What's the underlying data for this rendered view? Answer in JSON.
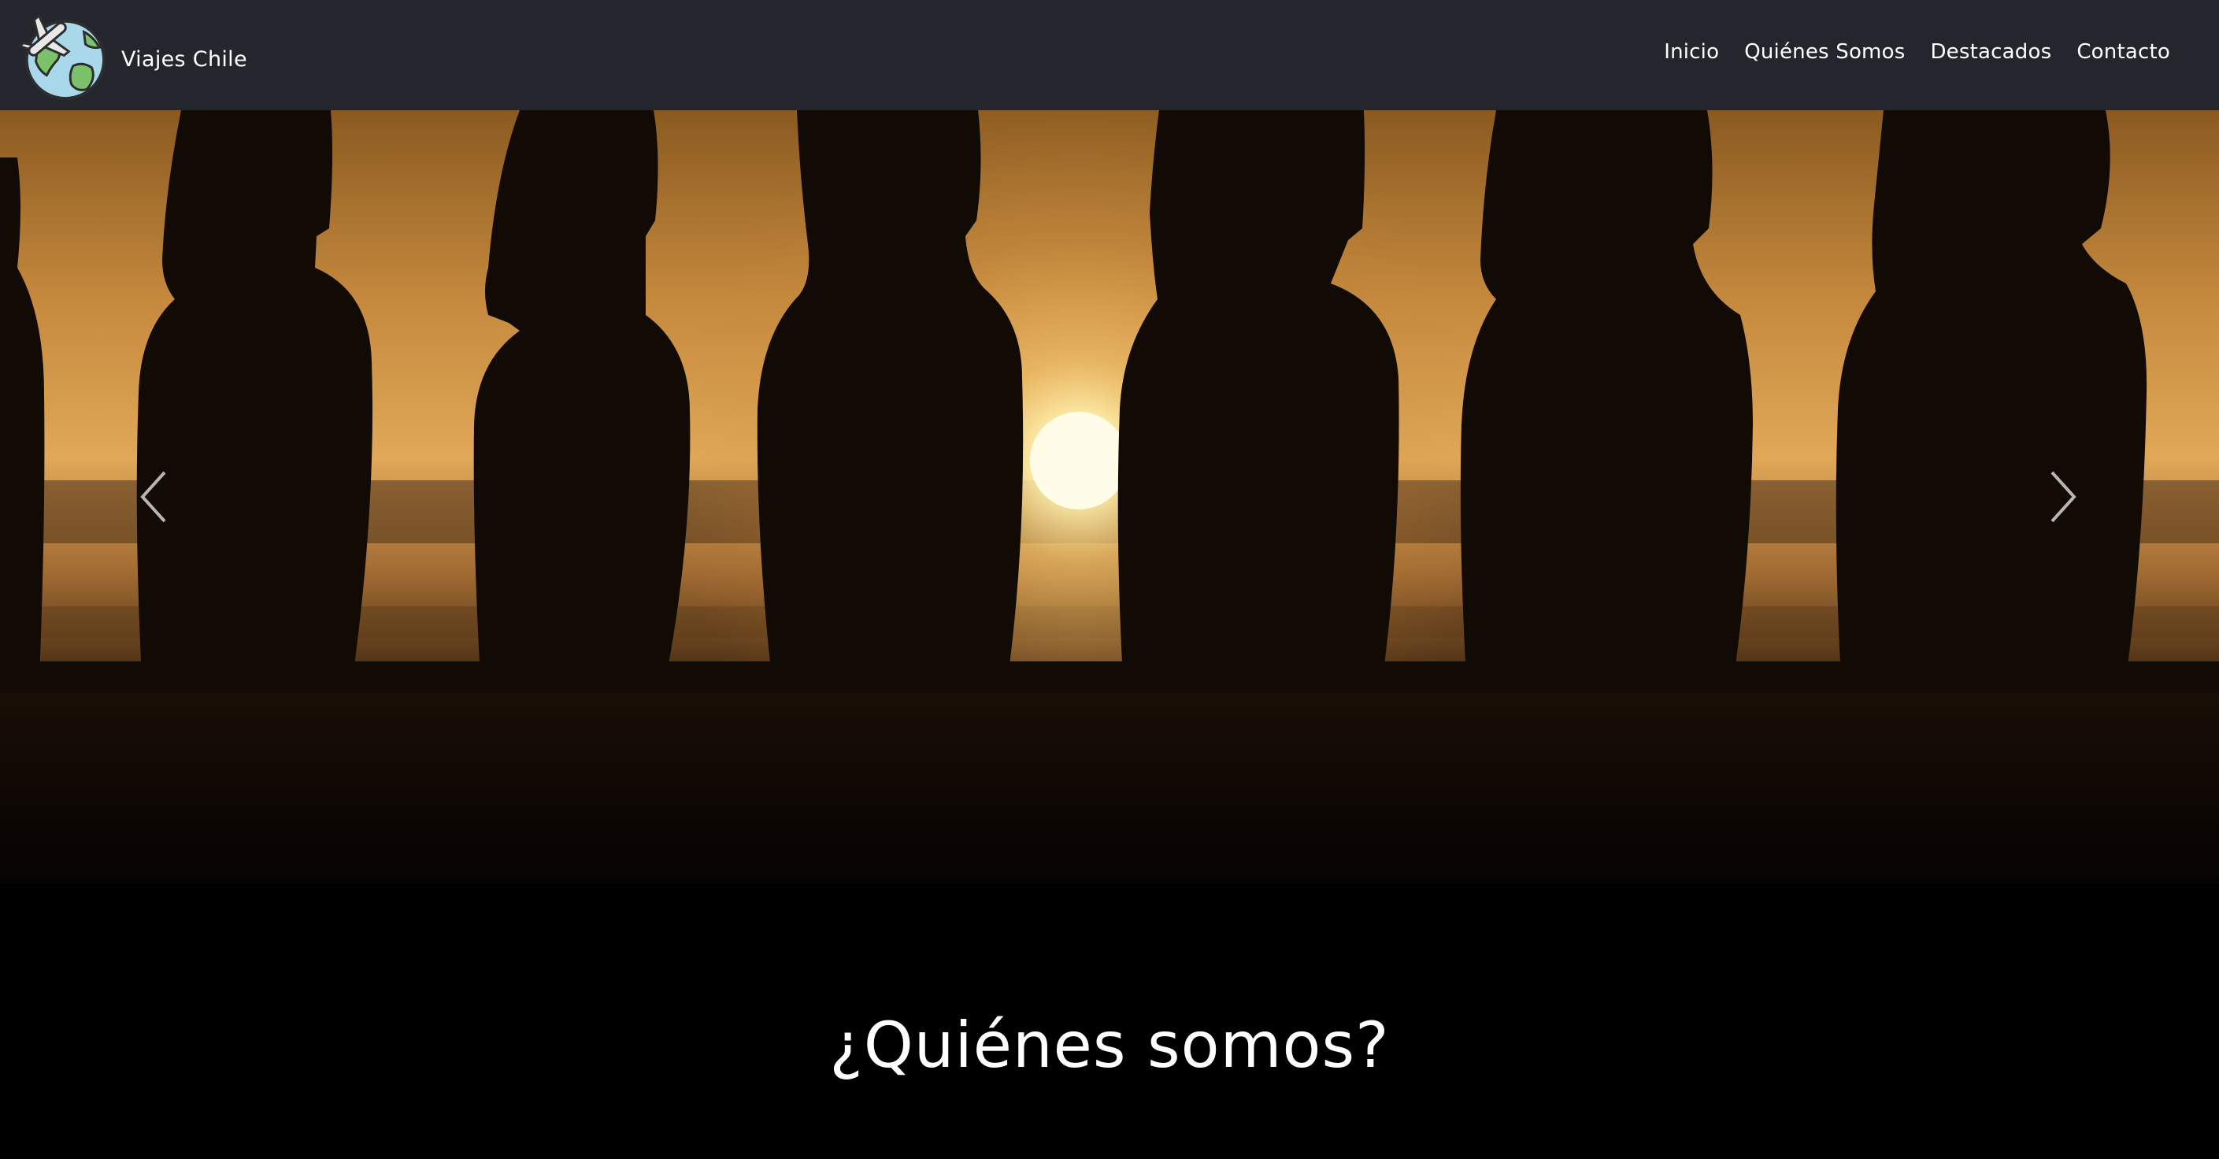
{
  "navbar": {
    "brand_name": "Viajes Chile",
    "logo_icon": "globe-airplane-icon",
    "links": [
      {
        "label": "Inicio"
      },
      {
        "label": "Quiénes Somos"
      },
      {
        "label": "Destacados"
      },
      {
        "label": "Contacto"
      }
    ]
  },
  "hero": {
    "image": "moai-statues-sunset",
    "prev_icon": "chevron-left-icon",
    "next_icon": "chevron-right-icon"
  },
  "about": {
    "title": "¿Quiénes somos?"
  },
  "colors": {
    "navbar_bg": "#23262c",
    "page_bg": "#000000",
    "text": "#ffffff"
  }
}
